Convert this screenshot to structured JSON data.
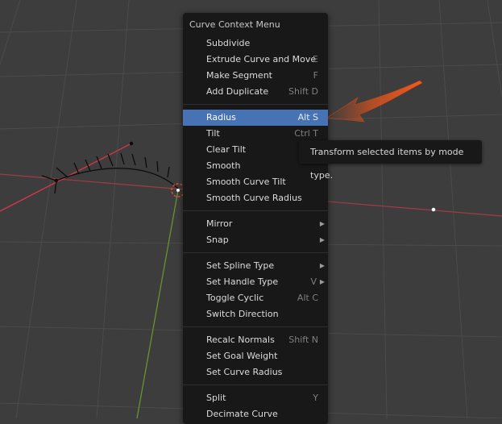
{
  "menu": {
    "title": "Curve Context Menu",
    "sections": [
      [
        {
          "label": "Subdivide",
          "shortcut": ""
        },
        {
          "label": "Extrude Curve and Move",
          "shortcut": "E"
        },
        {
          "label": "Make Segment",
          "shortcut": "F"
        },
        {
          "label": "Add Duplicate",
          "shortcut": "Shift D"
        }
      ],
      [
        {
          "label": "Radius",
          "shortcut": "Alt S",
          "active": true
        },
        {
          "label": "Tilt",
          "shortcut": "Ctrl T"
        },
        {
          "label": "Clear Tilt",
          "shortcut": ""
        },
        {
          "label": "Smooth",
          "shortcut": ""
        },
        {
          "label": "Smooth Curve Tilt",
          "shortcut": ""
        },
        {
          "label": "Smooth Curve Radius",
          "shortcut": ""
        }
      ],
      [
        {
          "label": "Mirror",
          "shortcut": "",
          "submenu": true
        },
        {
          "label": "Snap",
          "shortcut": "",
          "submenu": true
        }
      ],
      [
        {
          "label": "Set Spline Type",
          "shortcut": "",
          "submenu": true
        },
        {
          "label": "Set Handle Type",
          "shortcut": "V",
          "submenu": true
        },
        {
          "label": "Toggle Cyclic",
          "shortcut": "Alt C"
        },
        {
          "label": "Switch Direction",
          "shortcut": ""
        }
      ],
      [
        {
          "label": "Recalc Normals",
          "shortcut": "Shift N"
        },
        {
          "label": "Set Goal Weight",
          "shortcut": ""
        },
        {
          "label": "Set Curve Radius",
          "shortcut": ""
        }
      ],
      [
        {
          "label": "Split",
          "shortcut": "Y"
        },
        {
          "label": "Decimate Curve",
          "shortcut": ""
        }
      ]
    ]
  },
  "tooltip": {
    "text": "Transform selected items by mode type."
  },
  "colors": {
    "viewport_bg": "#3d3d3d",
    "grid": "#4a4a4a",
    "x_axis": "#a33a45",
    "y_axis": "#6a9a2e",
    "menu_bg": "#181818",
    "highlight": "#4772b3",
    "arrow": "#e8561c"
  },
  "icons": [
    "submenu-arrow-icon",
    "callout-arrow-icon"
  ]
}
